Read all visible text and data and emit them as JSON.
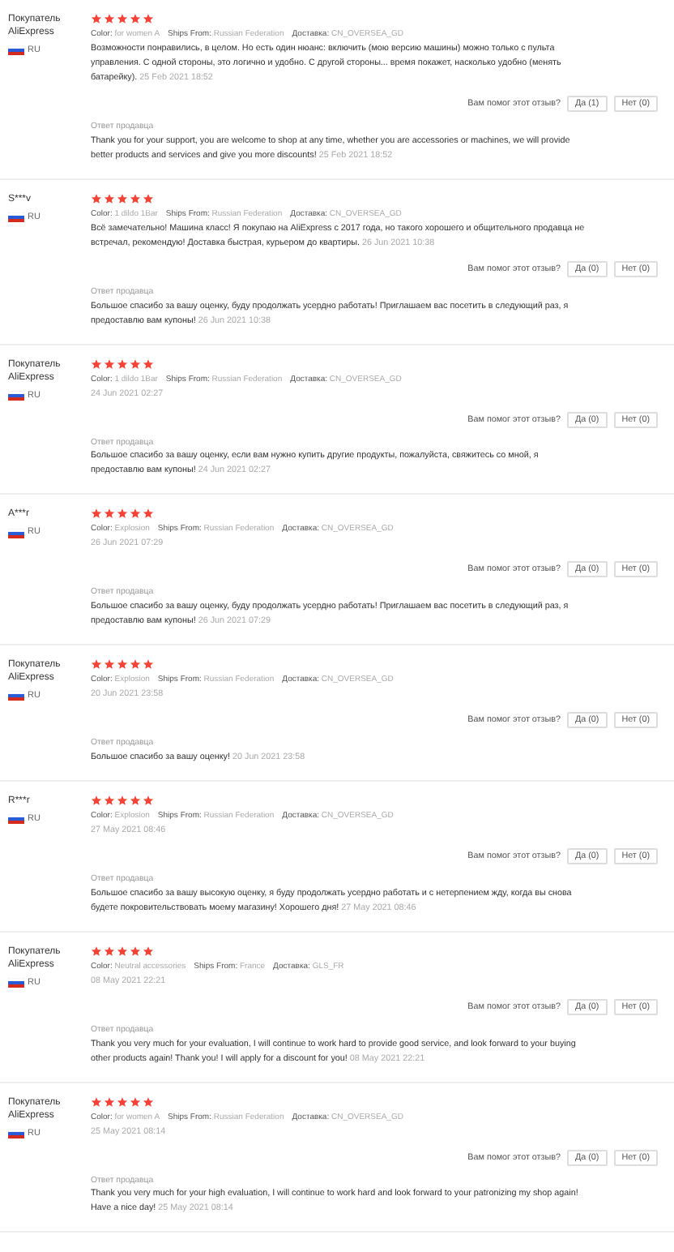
{
  "reviews": [
    {
      "author": "Покупатель AliExpress",
      "country": "RU",
      "stars": 5,
      "meta": [
        {
          "label": "Color:",
          "value": "for women A"
        },
        {
          "label": "Ships From:",
          "value": "Russian Federation"
        },
        {
          "label": "Доставка:",
          "value": "CN_OVERSEA_GD"
        }
      ],
      "comment": "Возможности понравились, в целом. Но есть один нюанс: включить (мою версию машины) можно только с пульта управления. С одной стороны, это логично и удобно. С другой стороны... время покажет, насколько удобно (менять батарейку).",
      "date": "25 Feb 2021 18:52",
      "helpful": "Вам помог этот отзыв?",
      "yes": "Да (1)",
      "no": "Нет (0)",
      "reply_label": "Ответ продавца",
      "reply": "Thank you for your support, you are welcome to shop at any time, whether you are accessories or machines, we will provide better products and services and give you more discounts!",
      "reply_date": "25 Feb 2021 18:52"
    },
    {
      "author": "S***v",
      "country": "RU",
      "stars": 5,
      "meta": [
        {
          "label": "Color:",
          "value": "1 dildo 1Bar"
        },
        {
          "label": "Ships From:",
          "value": "Russian Federation"
        },
        {
          "label": "Доставка:",
          "value": "CN_OVERSEA_GD"
        }
      ],
      "comment": "Всё замечательно! Машина класс! Я покупаю на AliExpress с 2017 года, но такого хорошего и общительного продавца не встречал, рекомендую! Доставка быстрая, курьером до квартиры.",
      "date": "26 Jun 2021 10:38",
      "helpful": "Вам помог этот отзыв?",
      "yes": "Да (0)",
      "no": "Нет (0)",
      "reply_label": "Ответ продавца",
      "reply": "Большое спасибо за вашу оценку, буду продолжать усердно работать! Приглашаем вас посетить в следующий раз, я предоставлю вам купоны!",
      "reply_date": "26 Jun 2021 10:38"
    },
    {
      "author": "Покупатель AliExpress",
      "country": "RU",
      "stars": 5,
      "meta": [
        {
          "label": "Color:",
          "value": "1 dildo 1Bar"
        },
        {
          "label": "Ships From:",
          "value": "Russian Federation"
        },
        {
          "label": "Доставка:",
          "value": "CN_OVERSEA_GD"
        }
      ],
      "date": "24 Jun 2021 02:27",
      "helpful": "Вам помог этот отзыв?",
      "yes": "Да (0)",
      "no": "Нет (0)",
      "reply_label": "Ответ продавца",
      "reply": "Большое спасибо за вашу оценку, если вам нужно купить другие продукты, пожалуйста, свяжитесь со мной, я предоставлю вам купоны!",
      "reply_date": "24 Jun 2021 02:27"
    },
    {
      "author": "A***r",
      "country": "RU",
      "stars": 5,
      "meta": [
        {
          "label": "Color:",
          "value": "Explosion"
        },
        {
          "label": "Ships From:",
          "value": "Russian Federation"
        },
        {
          "label": "Доставка:",
          "value": "CN_OVERSEA_GD"
        }
      ],
      "date": "26 Jun 2021 07:29",
      "helpful": "Вам помог этот отзыв?",
      "yes": "Да (0)",
      "no": "Нет (0)",
      "reply_label": "Ответ продавца",
      "reply": "Большое спасибо за вашу оценку, буду продолжать усердно работать! Приглашаем вас посетить в следующий раз, я предоставлю вам купоны!",
      "reply_date": "26 Jun 2021 07:29"
    },
    {
      "author": "Покупатель AliExpress",
      "country": "RU",
      "stars": 5,
      "meta": [
        {
          "label": "Color:",
          "value": "Explosion"
        },
        {
          "label": "Ships From:",
          "value": "Russian Federation"
        },
        {
          "label": "Доставка:",
          "value": "CN_OVERSEA_GD"
        }
      ],
      "date": "20 Jun 2021 23:58",
      "helpful": "Вам помог этот отзыв?",
      "yes": "Да (0)",
      "no": "Нет (0)",
      "reply_label": "Ответ продавца",
      "reply": "Большое спасибо за вашу оценку!",
      "reply_date": "20 Jun 2021 23:58"
    },
    {
      "author": "R***r",
      "country": "RU",
      "stars": 5,
      "meta": [
        {
          "label": "Color:",
          "value": "Explosion"
        },
        {
          "label": "Ships From:",
          "value": "Russian Federation"
        },
        {
          "label": "Доставка:",
          "value": "CN_OVERSEA_GD"
        }
      ],
      "date": "27 May 2021 08:46",
      "helpful": "Вам помог этот отзыв?",
      "yes": "Да (0)",
      "no": "Нет (0)",
      "reply_label": "Ответ продавца",
      "reply": "Большое спасибо за вашу высокую оценку, я буду продолжать усердно работать и с нетерпением жду, когда вы снова будете покровительствовать моему магазину! Хорошего дня!",
      "reply_date": "27 May 2021 08:46"
    },
    {
      "author": "Покупатель AliExpress",
      "country": "RU",
      "stars": 5,
      "meta": [
        {
          "label": "Color:",
          "value": "Neutral accessories"
        },
        {
          "label": "Ships From:",
          "value": "France"
        },
        {
          "label": "Доставка:",
          "value": "GLS_FR"
        }
      ],
      "date": "08 May 2021 22:21",
      "helpful": "Вам помог этот отзыв?",
      "yes": "Да (0)",
      "no": "Нет (0)",
      "reply_label": "Ответ продавца",
      "reply": "Thank you very much for your evaluation, I will continue to work hard to provide good service, and look forward to your buying other products again! Thank you! I will apply for a discount for you!",
      "reply_date": "08 May 2021 22:21"
    },
    {
      "author": "Покупатель AliExpress",
      "country": "RU",
      "stars": 5,
      "meta": [
        {
          "label": "Color:",
          "value": "for women A"
        },
        {
          "label": "Ships From:",
          "value": "Russian Federation"
        },
        {
          "label": "Доставка:",
          "value": "CN_OVERSEA_GD"
        }
      ],
      "date": "25 May 2021 08:14",
      "helpful": "Вам помог этот отзыв?",
      "yes": "Да (0)",
      "no": "Нет (0)",
      "reply_label": "Ответ продавца",
      "reply": "Thank you very much for your high evaluation, I will continue to work hard and look forward to your patronizing my shop again! Have a nice day!",
      "reply_date": "25 May 2021 08:14"
    }
  ]
}
